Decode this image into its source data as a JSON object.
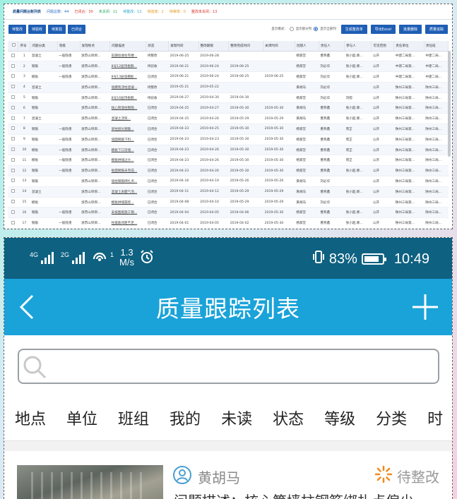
{
  "desktop": {
    "title": "质量问题台账列表",
    "stats": [
      {
        "label": "问题总数：44",
        "color": "#2b70c9"
      },
      {
        "label": "已闭合：30",
        "color": "#d9332b"
      },
      {
        "label": "未关闭：11",
        "color": "#2aa85c"
      },
      {
        "label": "待整改：12",
        "color": "#27a7c9"
      },
      {
        "label": "待验收：2",
        "color": "#e39a1e"
      },
      {
        "label": "待审核：0",
        "color": "#e39a1e"
      },
      {
        "label": "整改未关闭：13",
        "color": "#d9332b"
      }
    ],
    "buttons_left": [
      "待整改",
      "待验收",
      "待复验",
      "已闭合"
    ],
    "display_mode_label": "显示模式：",
    "radio_some": "显示部分列",
    "radio_all": "显示全部列",
    "buttons_right": [
      "生成整改单",
      "导出Excel",
      "批量删除",
      "质量追踪"
    ],
    "columns": [
      "",
      "序号",
      "问题分类",
      "等级",
      "发现地点",
      "问题描述",
      "状态",
      "发现时间",
      "整改期限",
      "整改完成时间",
      "关闭时间",
      "创建人",
      "责任人",
      "参与人",
      "可见范围",
      "责任单位",
      "责任班"
    ],
    "rows": [
      [
        "1",
        "混凝土",
        "一般隐患",
        "浙苏山项目...",
        "前期验收住宅楼...",
        "待整改",
        "2019-06-25",
        "2019-06-28",
        "",
        "",
        "杨家堂",
        "曹燕鑫",
        "张小超,黎...",
        "公开",
        "中建二局第...",
        "中建二局..."
      ],
      [
        "2",
        "钢筋",
        "一般隐患",
        "浙苏山项目...",
        "8号12层顶板钢...",
        "待验收",
        "2019-06-21",
        "2019-06-24",
        "2019-06-25",
        "",
        "杨家堂",
        "刘必华",
        "张小超,黎...",
        "公开",
        "中建二局第...",
        "中建二局..."
      ],
      [
        "3",
        "模板",
        "一般隐患",
        "浙苏山项目...",
        "8号13层墙模板...",
        "已闭合",
        "2019-06-21",
        "2019-06-24",
        "2019-06-25",
        "2019-06-25",
        "杨家堂",
        "刘必华",
        "张小超,黎...",
        "公开",
        "中建二局第...",
        "中建二局..."
      ],
      [
        "4",
        "混凝土",
        "",
        "浙苏山项目...",
        "墙模现浇柱混凝...",
        "待整改",
        "2019-05-21",
        "2019-05-22",
        "",
        "",
        "黄胡马",
        "刘必华",
        "",
        "公开",
        "陕州三局第...",
        "陕州三局..."
      ],
      [
        "5",
        "钢筋",
        "",
        "浙苏山项目...",
        "8号16层顶板钢...",
        "待验收",
        "2019-04-27",
        "2019-04-30",
        "2019-04-30",
        "",
        "杨家堂",
        "刘必华",
        "刘旭",
        "公开",
        "陕州三局第...",
        "陕州三局..."
      ],
      [
        "6",
        "钢筋",
        "",
        "浙苏山项目...",
        "核心筒墙柱钢筋...",
        "已闭合",
        "2019-04-25",
        "2019-04-27",
        "2019-05-30",
        "2019-05-30",
        "黄胡马",
        "曹燕鑫",
        "张小超,黎...",
        "公开",
        "陕州三局第...",
        "陕州三局..."
      ],
      [
        "7",
        "混凝土",
        "",
        "浙苏山项目...",
        "混凝土浇筑...",
        "已闭合",
        "2019-04-25",
        "2019-04-26",
        "2019-05-29",
        "2019-05-29",
        "黄胡马",
        "曹燕鑫",
        "张小超,黎...",
        "公开",
        "陕州三局第...",
        "陕州三局..."
      ],
      [
        "8",
        "钢筋",
        "一般隐患",
        "浙苏山项目...",
        "梁柱接头钢筋...",
        "已闭合",
        "2019-04-23",
        "2019-04-25",
        "2019-05-30",
        "2019-05-30",
        "杨家堂",
        "曹燕鑫",
        "周芷",
        "公开",
        "陕州三局第...",
        "陕州三局..."
      ],
      [
        "9",
        "钢筋",
        "一般隐患",
        "浙苏山项目...",
        "墙面钢筋下料...",
        "已闭合",
        "2019-04-23",
        "2019-04-23",
        "2019-05-30",
        "2019-05-30",
        "杨家堂",
        "曹燕鑫",
        "周芷",
        "公开",
        "陕州三局第...",
        "陕州三局..."
      ],
      [
        "10",
        "模板",
        "一般隐患",
        "浙苏山项目...",
        "模板下口牙缝...",
        "已闭合",
        "2019-04-23",
        "2019-04-26",
        "2019-05-30",
        "2019-05-30",
        "杨家堂",
        "曹燕鑫",
        "周芷",
        "公开",
        "陕州三局第...",
        "陕州三局..."
      ],
      [
        "11",
        "模板",
        "一般隐患",
        "浙苏山项目...",
        "模板拼缝过大...",
        "已闭合",
        "2019-04-23",
        "2019-04-26",
        "2019-05-30",
        "2019-05-30",
        "杨家堂",
        "曹燕鑫",
        "周芷",
        "公开",
        "陕州三局第...",
        "陕州三局..."
      ],
      [
        "12",
        "钢筋",
        "一般隐患",
        "浙苏山项目...",
        "板面钢筋未完成...",
        "已闭合",
        "2019-04-23",
        "2019-04-26",
        "2019-05-30",
        "2019-05-30",
        "杨家堂",
        "曹燕鑫",
        "张小超,黎...",
        "公开",
        "陕州三局第...",
        "陕州三局..."
      ],
      [
        "13",
        "钢筋",
        "",
        "浙苏山项目...",
        "墙柱钢筋绑扎点...",
        "已闭合",
        "2019-04-16",
        "2019-04-19",
        "2019-05-26",
        "2019-05-26",
        "黄胡马",
        "刘必华",
        "",
        "公开",
        "陕州三局第...",
        "陕州三局..."
      ],
      [
        "14",
        "混凝土",
        "",
        "浙苏山项目...",
        "混凝土表面气泡...",
        "已闭合",
        "2019-04-11",
        "2019-04-12",
        "2019-05-29",
        "2019-05-29",
        "黄胡马",
        "曹燕鑫",
        "张小超,黎...",
        "公开",
        "陕州三局第...",
        "陕州三局..."
      ],
      [
        "15",
        "模板",
        "",
        "浙苏山项目...",
        "模板拼缝漏浆...",
        "已闭合",
        "2019-04-08",
        "2019-04-10",
        "2019-05-29",
        "2019-05-29",
        "黄胡马",
        "刘必华",
        "",
        "公开",
        "陕州三局第...",
        "陕州三局..."
      ],
      [
        "16",
        "钢筋",
        "一般隐患",
        "浙苏山项目...",
        "未按图纸施工钢...",
        "已闭合",
        "2019-04-04",
        "2019-04-05",
        "2019-04-06",
        "2019-05-30",
        "杨家堂",
        "曹燕鑫",
        "张小超,黎...",
        "公开",
        "陕州三局第...",
        "陕州三局..."
      ],
      [
        "17",
        "钢筋",
        "一般隐患",
        "浙苏山项目...",
        "柱箍筋间距不足...",
        "已闭合",
        "2019-04-01",
        "2019-04-05",
        "2019-04-02",
        "2019-05-30",
        "杨家堂",
        "曹燕鑫",
        "张小超,黎...",
        "公开",
        "陕州三局第...",
        "陕州三局..."
      ]
    ]
  },
  "phone": {
    "status": {
      "net1": "4G",
      "net2": "2G",
      "hotspot_num": "1",
      "speed_value": "1.3",
      "speed_unit": "M/s",
      "battery": "83%",
      "time": "10:49",
      "battery_level": 0.83
    },
    "title": "质量跟踪列表",
    "search_placeholder": "",
    "filters": [
      "地点",
      "单位",
      "班组",
      "我的",
      "未读",
      "状态",
      "等级",
      "分类",
      "时"
    ],
    "card": {
      "person": "黄胡马",
      "state": "待整改",
      "description": "问题描述：核心筒墙柱钢筋绑扎点偏少"
    },
    "icons": {
      "back": "chevron-left-icon",
      "add": "plus-icon",
      "search": "search-icon",
      "person": "person-icon",
      "state": "pending-icon"
    }
  }
}
